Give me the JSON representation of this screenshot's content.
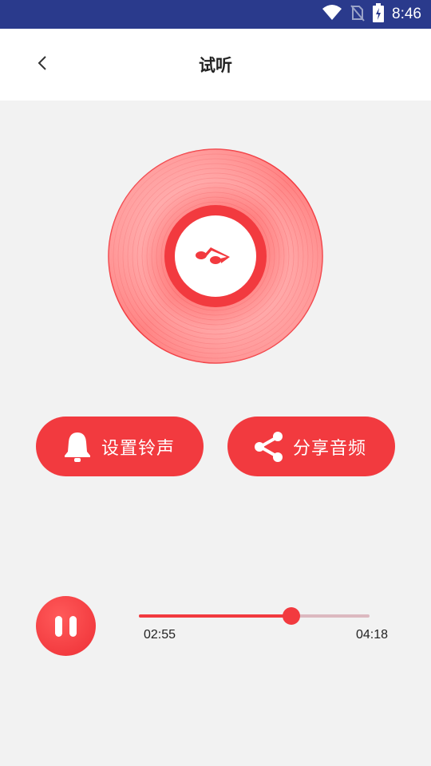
{
  "status_bar": {
    "time": "8:46",
    "icons": [
      "wifi-icon",
      "no-sim-icon",
      "battery-charging-icon"
    ]
  },
  "header": {
    "title": "试听",
    "back_icon": "chevron-left-icon"
  },
  "disc": {
    "icon": "music-note-icon",
    "colors": {
      "primary": "#f23a3f",
      "light": "#ff8f8f"
    }
  },
  "actions": {
    "set_ringtone": {
      "label": "设置铃声",
      "icon": "bell-icon"
    },
    "share_audio": {
      "label": "分享音频",
      "icon": "share-icon"
    }
  },
  "player": {
    "state_icon": "pause-icon",
    "current_time": "02:55",
    "total_time": "04:18",
    "progress": 0.66
  },
  "colors": {
    "accent": "#f23a3f",
    "status_bar": "#2a3a8c",
    "track": "#dcb9c0",
    "background": "#f2f2f2"
  }
}
